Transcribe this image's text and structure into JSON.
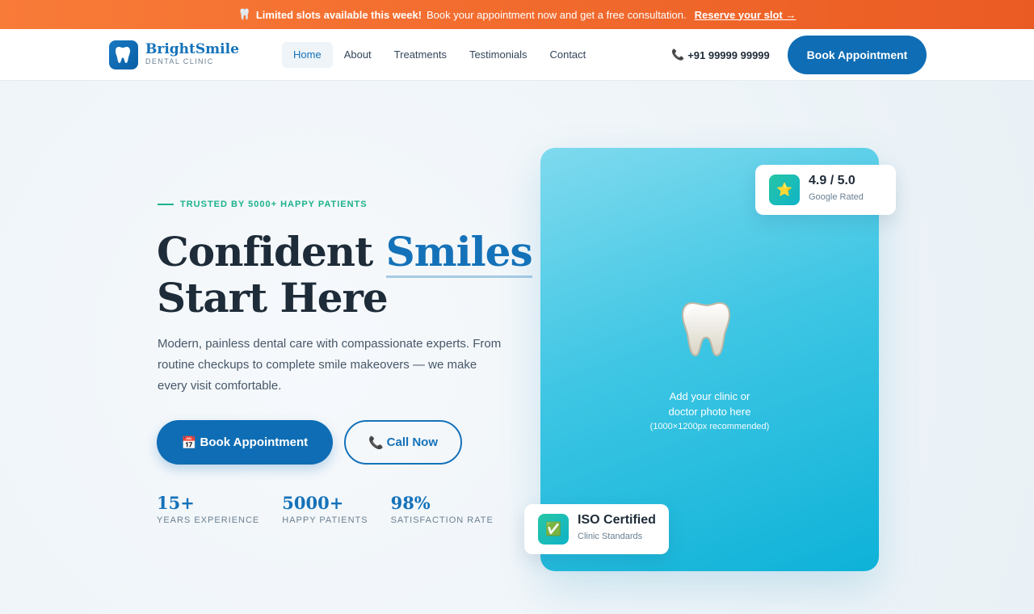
{
  "announcement": {
    "emoji": "🦷",
    "strong": "Limited slots available this week!",
    "text": "Book your appointment now and get a free consultation.",
    "link": "Reserve your slot →"
  },
  "header": {
    "brand_name": "BrightSmile",
    "brand_sub": "DENTAL CLINIC",
    "nav": [
      "Home",
      "About",
      "Treatments",
      "Testimonials",
      "Contact"
    ],
    "active_nav": "Home",
    "phone_icon": "📞",
    "phone": "+91 99999 99999",
    "cta": "Book Appointment"
  },
  "hero": {
    "trusted": "TRUSTED BY 5000+ HAPPY PATIENTS",
    "headline_1": "Confident",
    "headline_accent": "Smiles",
    "headline_2": "Start Here",
    "description": "Modern, painless dental care with compassionate experts. From routine checkups to complete smile makeovers — we make every visit comfortable.",
    "primary_icon": "📅",
    "primary_label": "Book Appointment",
    "secondary_icon": "📞",
    "secondary_label": "Call Now",
    "stats": [
      {
        "value": "15+",
        "label": "YEARS EXPERIENCE"
      },
      {
        "value": "5000+",
        "label": "HAPPY PATIENTS"
      },
      {
        "value": "98%",
        "label": "SATISFACTION RATE"
      }
    ]
  },
  "photo": {
    "line_1": "Add your clinic or",
    "line_2": "doctor photo here",
    "small": "(1000×1200px recommended)"
  },
  "rating": {
    "title": "4.9 / 5.0",
    "sub": "Google Rated",
    "icon": "⭐"
  },
  "iso": {
    "title": "ISO Certified",
    "sub": "Clinic Standards",
    "icon": "✅"
  },
  "colors": {
    "brand": "#1572b9",
    "accent_green": "#1cb28c",
    "banner": "#f26b2d",
    "photo": "#29bfe0"
  }
}
